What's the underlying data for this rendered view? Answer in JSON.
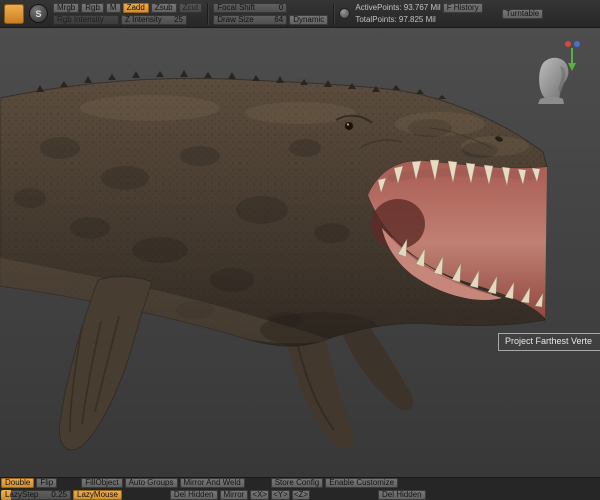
{
  "topbar": {
    "brush_letter": "S",
    "mrgb": "Mrgb",
    "rgb": "Rgb",
    "m": "M",
    "zadd": "Zadd",
    "zsub": "Zsub",
    "zcut": "Zcut",
    "rgb_intensity_label": "Rgb Intensity",
    "z_intensity_label": "Z Intensity",
    "z_intensity_value": "25",
    "focal_shift_label": "Focal Shift",
    "focal_shift_value": "0",
    "draw_size_label": "Draw Size",
    "draw_size_value": "64",
    "dynamic_label": "Dynamic",
    "active_points": "ActivePoints: 93.767 Mil",
    "total_points": "TotalPoints: 97.825 Mil",
    "history_label": "F History",
    "turntable_label": "Turntable"
  },
  "canvas": {
    "tooltip": "Project Farthest Verte",
    "model": "mosasaur-sculpt-open-mouth"
  },
  "bottombar": {
    "double": "Double",
    "flip": "Flip",
    "fillobject": "FillObject",
    "auto_groups": "Auto Groups",
    "mirror_and_weld": "Mirror And Weld",
    "store_config": "Store Config",
    "enable_customize": "Enable Customize",
    "lazystep_label": "LazyStep",
    "lazystep_value": "0.25",
    "lazymouse": "LazyMouse",
    "del_hidden": "Del Hidden",
    "mirror": "Mirror",
    "axis_x": "<X>",
    "axis_y": "<Y>",
    "axis_z": "<Z>",
    "del_hidden2": "Del Hidden"
  },
  "colors": {
    "accent_orange": "#dd9a3c",
    "canvas_top": "#4d4d4d",
    "canvas_bottom": "#383838",
    "mouth_pink": "#c08074"
  }
}
